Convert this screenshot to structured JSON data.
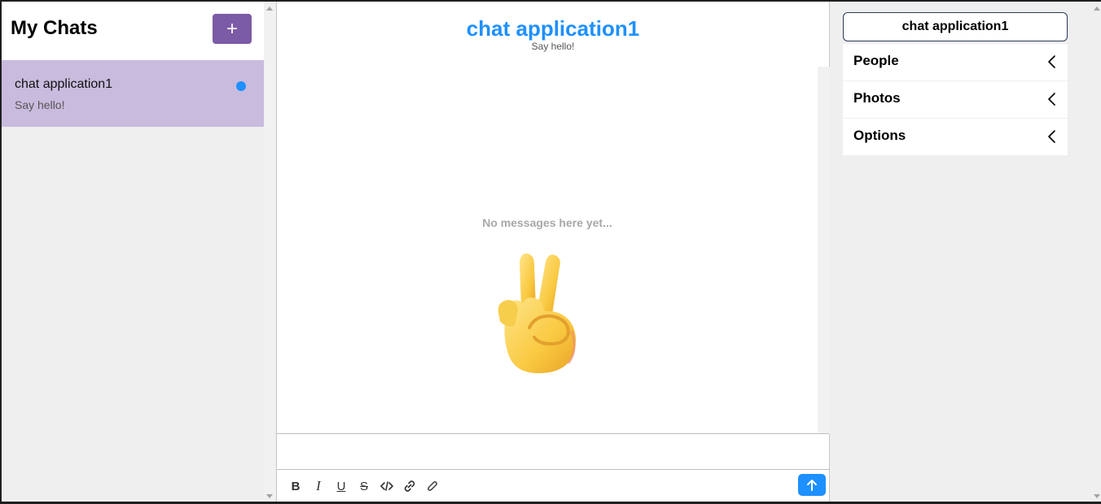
{
  "sidebar": {
    "title": "My Chats",
    "new_chat_label": "+",
    "chats": [
      {
        "title": "chat application1",
        "subtitle": "Say hello!",
        "unread": true
      }
    ]
  },
  "chat": {
    "title": "chat application1",
    "subtitle": "Say hello!",
    "empty_text": "No messages here yet...",
    "empty_icon": "victory-hand-emoji",
    "composer_placeholder": "",
    "toolbar": [
      "bold-icon",
      "italic-icon",
      "underline-icon",
      "strikethrough-icon",
      "code-icon",
      "link-icon",
      "attachment-icon"
    ],
    "send_icon": "arrow-up-icon"
  },
  "settings": {
    "title": "chat application1",
    "sections": [
      {
        "label": "People"
      },
      {
        "label": "Photos"
      },
      {
        "label": "Options"
      }
    ]
  },
  "colors": {
    "accent_purple": "#7b5aa6",
    "selected_chat": "#c9bbde",
    "accent_blue": "#1e90ff",
    "panel_bg": "#efefef"
  }
}
